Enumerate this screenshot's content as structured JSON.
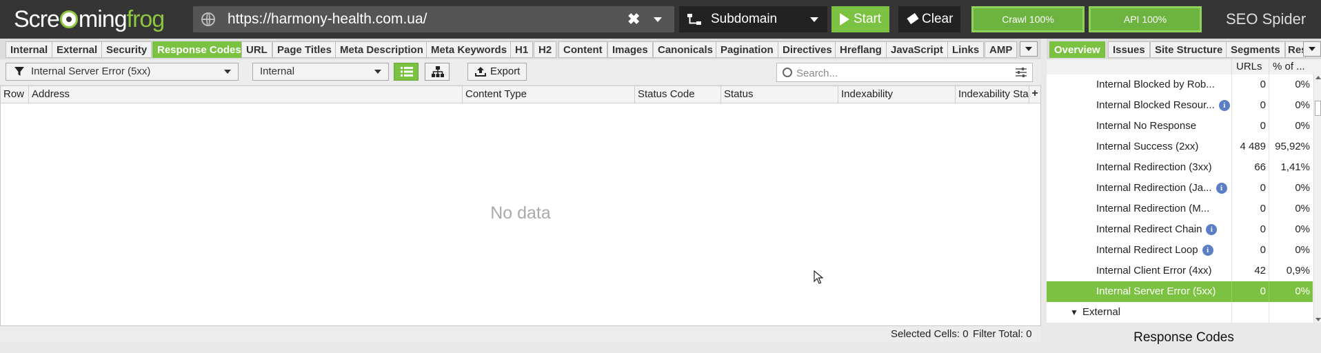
{
  "app": {
    "logo_text_a": "Scre",
    "logo_text_b": "ming",
    "logo_text_c": "frog",
    "brand": "SEO Spider"
  },
  "toolbar": {
    "url_value": "https://harmony-health.com.ua/",
    "clear_url_glyph": "✖",
    "mode_label": "Subdomain",
    "start_label": "Start",
    "clear_label": "Clear",
    "crawl_progress": "Crawl 100%",
    "api_progress": "API 100%"
  },
  "main_tabs": [
    {
      "label": "Internal"
    },
    {
      "label": "External"
    },
    {
      "label": "Security"
    },
    {
      "label": "Response Codes",
      "active": true
    },
    {
      "label": "URL"
    },
    {
      "label": "Page Titles"
    },
    {
      "label": "Meta Description"
    },
    {
      "label": "Meta Keywords"
    },
    {
      "label": "H1"
    },
    {
      "label": "H2"
    },
    {
      "label": "Content"
    },
    {
      "label": "Images"
    },
    {
      "label": "Canonicals"
    },
    {
      "label": "Pagination"
    },
    {
      "label": "Directives"
    },
    {
      "label": "Hreflang"
    },
    {
      "label": "JavaScript"
    },
    {
      "label": "Links"
    },
    {
      "label": "AMP"
    }
  ],
  "right_tabs": [
    {
      "label": "Overview",
      "active": true
    },
    {
      "label": "Issues"
    },
    {
      "label": "Site Structure"
    },
    {
      "label": "Segments"
    },
    {
      "label": "Res"
    }
  ],
  "filters": {
    "filter_value": "Internal Server Error (5xx)",
    "scope_value": "Internal",
    "export_label": "Export",
    "search_placeholder": "Search..."
  },
  "grid": {
    "columns": [
      "Row",
      "Address",
      "Content Type",
      "Status Code",
      "Status",
      "Indexability",
      "Indexability Stat"
    ],
    "empty_text": "No data"
  },
  "status_bar": {
    "selected_cells": "Selected Cells:  0",
    "filter_total": "Filter Total:  0"
  },
  "overview": {
    "col_urls": "URLs",
    "col_pct": "% of ...",
    "rows": [
      {
        "label": "Internal Blocked by Rob...",
        "urls": "0",
        "pct": "0%",
        "info": false
      },
      {
        "label": "Internal Blocked Resour...",
        "urls": "0",
        "pct": "0%",
        "info": true
      },
      {
        "label": "Internal No Response",
        "urls": "0",
        "pct": "0%",
        "info": false
      },
      {
        "label": "Internal Success (2xx)",
        "urls": "4 489",
        "pct": "95,92%",
        "info": false
      },
      {
        "label": "Internal Redirection (3xx)",
        "urls": "66",
        "pct": "1,41%",
        "info": false
      },
      {
        "label": "Internal Redirection (Ja...",
        "urls": "0",
        "pct": "0%",
        "info": true
      },
      {
        "label": "Internal Redirection (M...",
        "urls": "0",
        "pct": "0%",
        "info": false
      },
      {
        "label": "Internal Redirect Chain",
        "urls": "0",
        "pct": "0%",
        "info": true
      },
      {
        "label": "Internal Redirect Loop",
        "urls": "0",
        "pct": "0%",
        "info": true
      },
      {
        "label": "Internal Client Error (4xx)",
        "urls": "42",
        "pct": "0,9%",
        "info": false
      },
      {
        "label": "Internal Server Error (5xx)",
        "urls": "0",
        "pct": "0%",
        "info": false,
        "selected": true
      }
    ],
    "group_label": "External",
    "group_arrow": "▼",
    "footer_title": "Response Codes"
  },
  "colors": {
    "accent": "#7cc242",
    "topbar": "#353535",
    "info": "#5b7fc4"
  }
}
